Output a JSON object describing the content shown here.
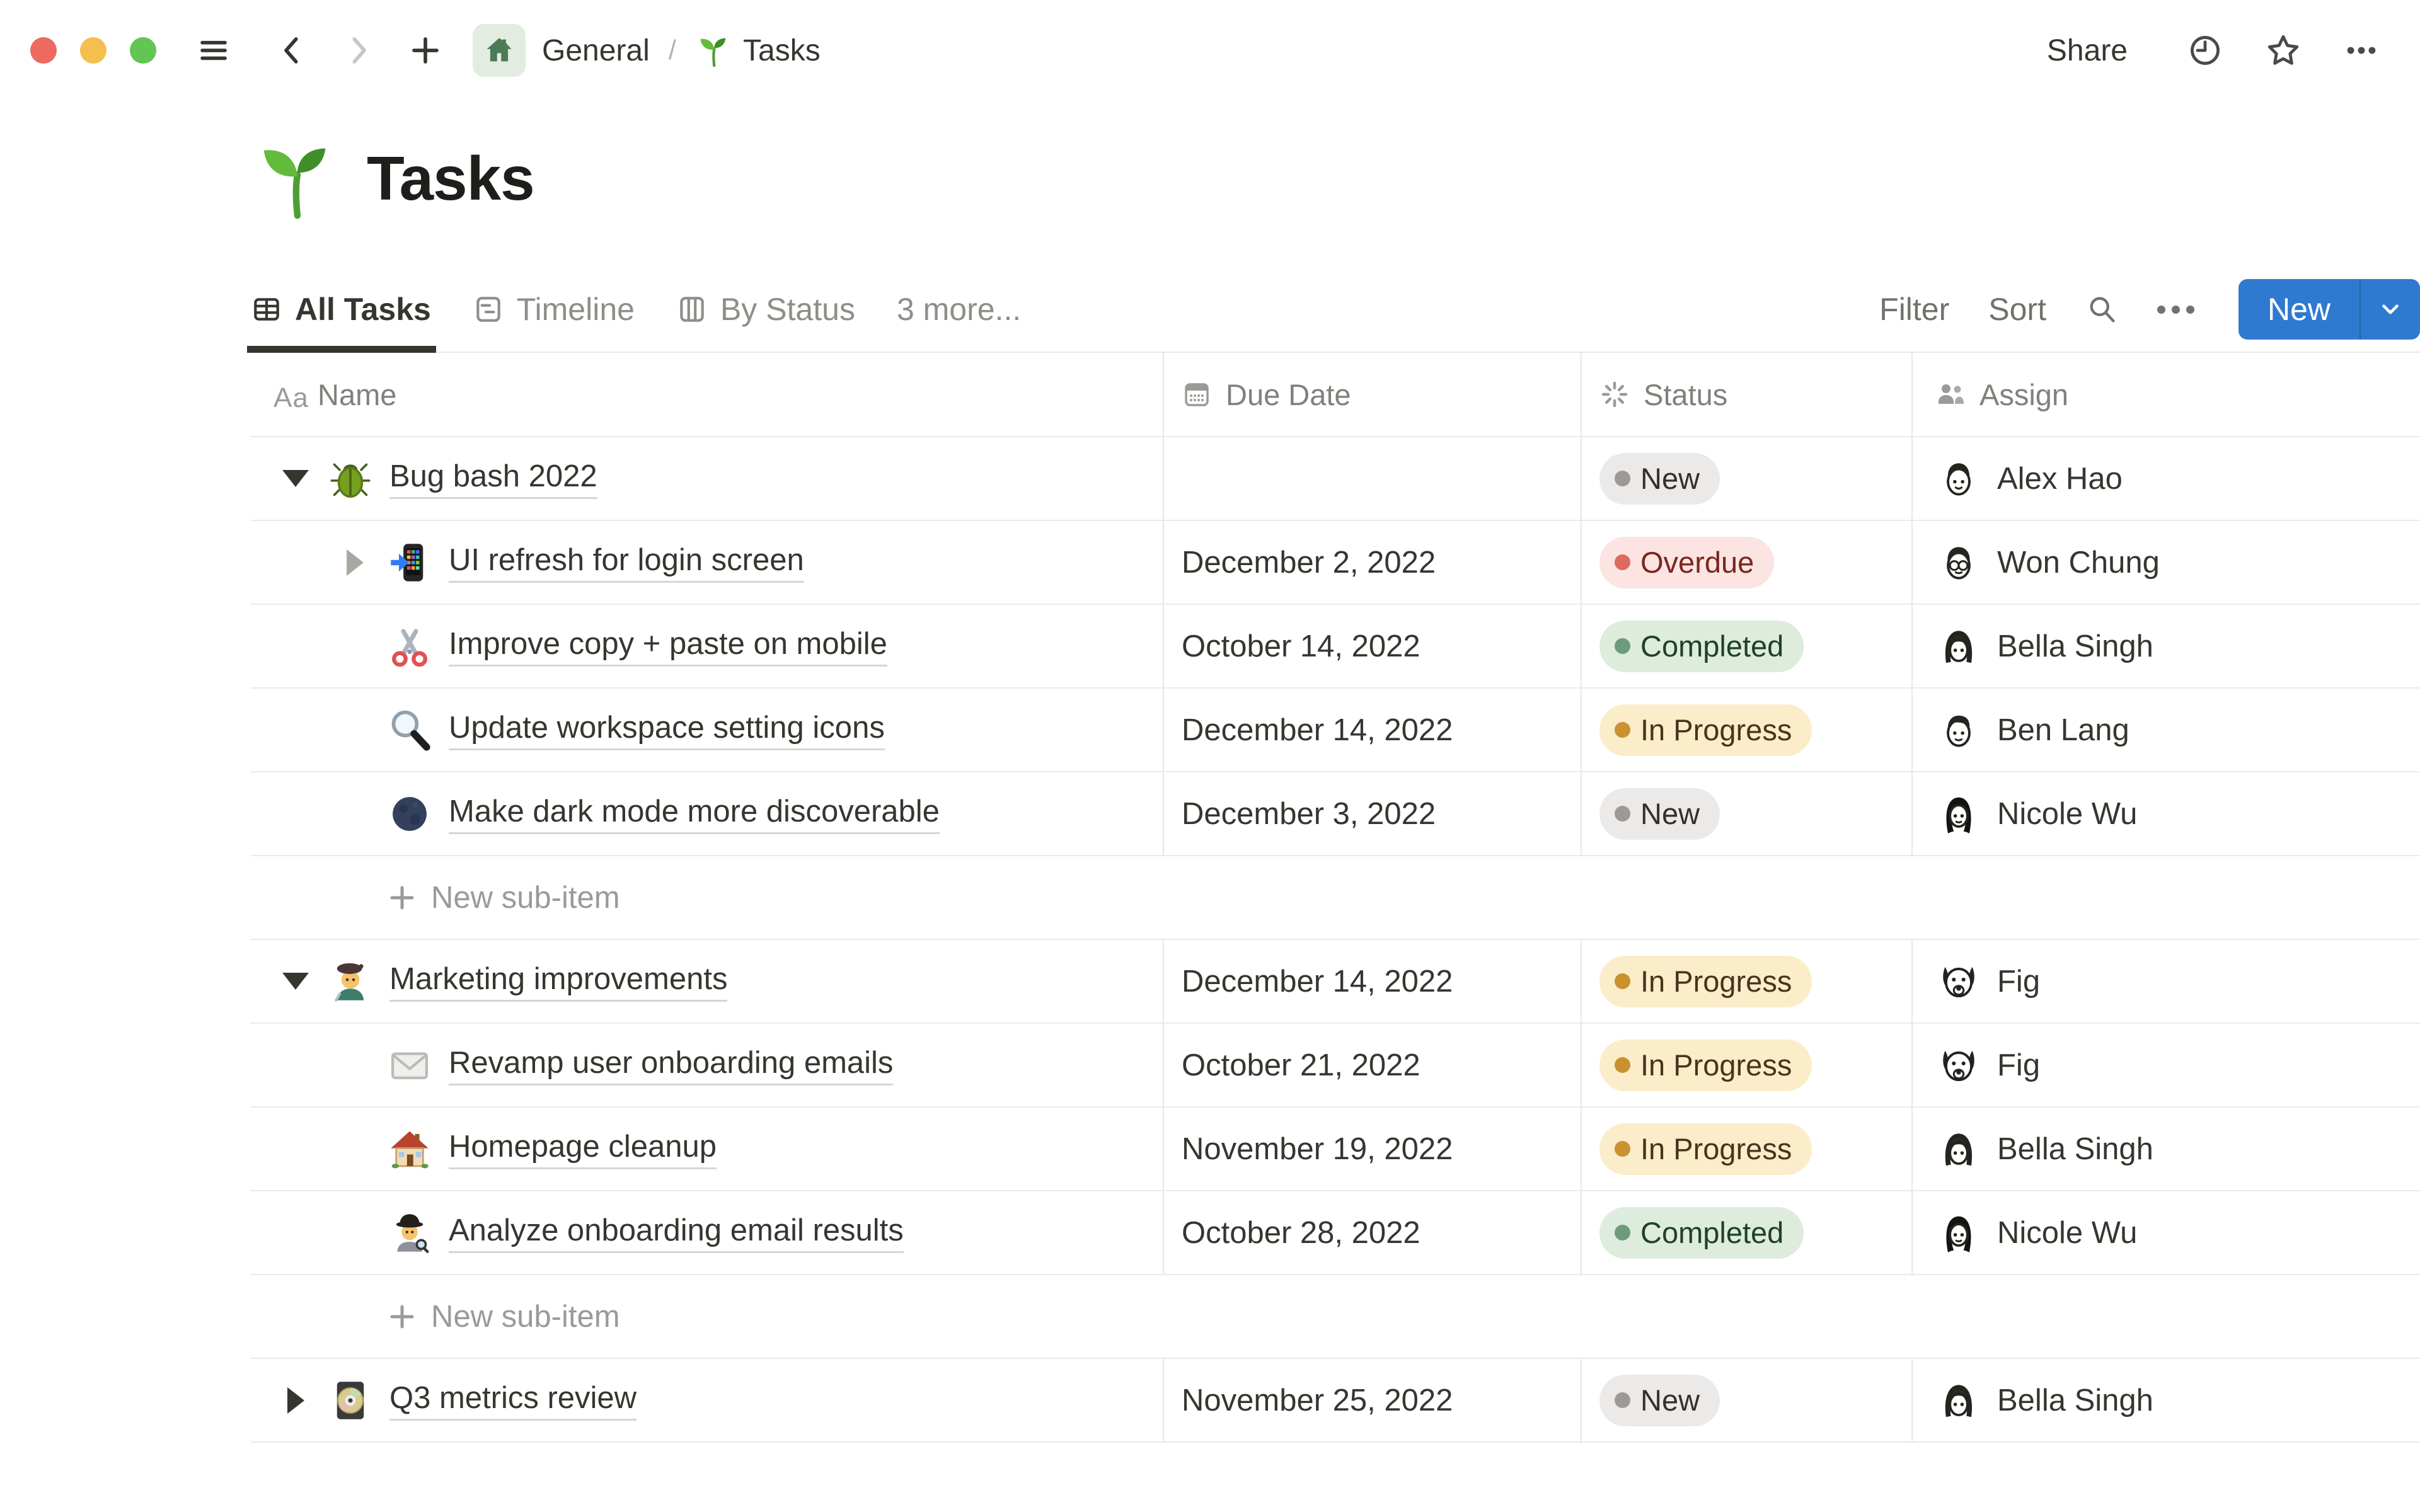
{
  "window": {
    "traffic_lights": [
      "#ec6a5e",
      "#f5bf4f",
      "#62c554"
    ],
    "nav": {
      "menu_icon": "hamburger-icon",
      "back_icon": "chevron-left-icon",
      "forward_icon": "chevron-right-icon",
      "new_page_icon": "plus-icon"
    },
    "breadcrumb": {
      "space_icon": "home-icon",
      "space_label": "General",
      "separator": "/",
      "page_icon": "seedling-icon",
      "page_label": "Tasks"
    },
    "actions": {
      "share_label": "Share",
      "history_icon": "clock-icon",
      "favorite_icon": "star-icon",
      "more_icon": "ellipsis-icon"
    }
  },
  "page": {
    "icon": "seedling-icon",
    "title": "Tasks"
  },
  "toolbar": {
    "tabs": [
      {
        "label": "All Tasks",
        "icon": "table-icon",
        "active": true
      },
      {
        "label": "Timeline",
        "icon": "timeline-icon",
        "active": false
      },
      {
        "label": "By Status",
        "icon": "board-icon",
        "active": false
      },
      {
        "label": "3 more...",
        "icon": null,
        "active": false
      }
    ],
    "filter_label": "Filter",
    "sort_label": "Sort",
    "search_icon": "search-icon",
    "more_icon": "ellipsis-icon",
    "new_button": {
      "label": "New",
      "caret_icon": "chevron-down-icon"
    }
  },
  "table": {
    "columns": [
      {
        "label": "Name",
        "icon": "text-icon"
      },
      {
        "label": "Due Date",
        "icon": "calendar-icon"
      },
      {
        "label": "Status",
        "icon": "spinner-icon"
      },
      {
        "label": "Assign",
        "icon": "people-icon"
      }
    ],
    "add_row_label": "New sub-item",
    "rows": [
      {
        "type": "task",
        "indent": 0,
        "toggle": "down",
        "toggle_shade": "dark",
        "icon": "beetle-icon",
        "name": "Bug bash 2022",
        "due": "",
        "status": {
          "label": "New",
          "variant": "gray"
        },
        "assignee": {
          "name": "Alex Hao",
          "avatar": "man-short-hair"
        }
      },
      {
        "type": "task",
        "indent": 1,
        "toggle": "right",
        "toggle_shade": "light",
        "icon": "phone-arrow-icon",
        "name": "UI refresh for login screen",
        "due": "December 2, 2022",
        "status": {
          "label": "Overdue",
          "variant": "red"
        },
        "assignee": {
          "name": "Won Chung",
          "avatar": "man-glasses"
        }
      },
      {
        "type": "task",
        "indent": 1,
        "toggle": null,
        "icon": "scissors-icon",
        "name": "Improve copy + paste on mobile",
        "due": "October 14, 2022",
        "status": {
          "label": "Completed",
          "variant": "green"
        },
        "assignee": {
          "name": "Bella Singh",
          "avatar": "woman-bob"
        }
      },
      {
        "type": "task",
        "indent": 1,
        "toggle": null,
        "icon": "magnifier-icon",
        "name": "Update workspace setting icons",
        "due": "December 14, 2022",
        "status": {
          "label": "In Progress",
          "variant": "yellow"
        },
        "assignee": {
          "name": "Ben Lang",
          "avatar": "man-side-part"
        }
      },
      {
        "type": "task",
        "indent": 1,
        "toggle": null,
        "icon": "dark-moon-icon",
        "name": "Make dark mode more discoverable",
        "due": "December 3, 2022",
        "status": {
          "label": "New",
          "variant": "gray"
        },
        "assignee": {
          "name": "Nicole Wu",
          "avatar": "woman-long-hair"
        }
      },
      {
        "type": "add"
      },
      {
        "type": "task",
        "indent": 0,
        "toggle": "down",
        "toggle_shade": "dark",
        "icon": "artist-icon",
        "name": "Marketing improvements",
        "due": "December 14, 2022",
        "status": {
          "label": "In Progress",
          "variant": "yellow"
        },
        "assignee": {
          "name": "Fig",
          "avatar": "dog"
        }
      },
      {
        "type": "task",
        "indent": 1,
        "toggle": null,
        "icon": "envelope-icon",
        "name": "Revamp user onboarding emails",
        "due": "October 21, 2022",
        "status": {
          "label": "In Progress",
          "variant": "yellow"
        },
        "assignee": {
          "name": "Fig",
          "avatar": "dog"
        }
      },
      {
        "type": "task",
        "indent": 1,
        "toggle": null,
        "icon": "house-emoji-icon",
        "name": "Homepage cleanup",
        "due": "November 19, 2022",
        "status": {
          "label": "In Progress",
          "variant": "yellow"
        },
        "assignee": {
          "name": "Bella Singh",
          "avatar": "woman-bob"
        }
      },
      {
        "type": "task",
        "indent": 1,
        "toggle": null,
        "icon": "detective-icon",
        "name": "Analyze onboarding email results",
        "due": "October 28, 2022",
        "status": {
          "label": "Completed",
          "variant": "green"
        },
        "assignee": {
          "name": "Nicole Wu",
          "avatar": "woman-long-hair"
        }
      },
      {
        "type": "add"
      },
      {
        "type": "task",
        "indent": 0,
        "toggle": "right",
        "toggle_shade": "dark",
        "icon": "dvd-icon",
        "name": "Q3 metrics review",
        "due": "November 25, 2022",
        "status": {
          "label": "New",
          "variant": "gray"
        },
        "assignee": {
          "name": "Bella Singh",
          "avatar": "woman-bob"
        }
      }
    ]
  },
  "colors": {
    "accent": "#2e7ad0",
    "status_variants": {
      "gray": {
        "bg": "#eceae9",
        "dot": "#9b9a97",
        "text": "#33312d"
      },
      "red": {
        "bg": "#fbe4e2",
        "dot": "#dd6a5e",
        "text": "#79271e"
      },
      "green": {
        "bg": "#ddecdd",
        "dot": "#6d9b7c",
        "text": "#20402c"
      },
      "yellow": {
        "bg": "#fbecca",
        "dot": "#c9912f",
        "text": "#4a331d"
      }
    }
  }
}
